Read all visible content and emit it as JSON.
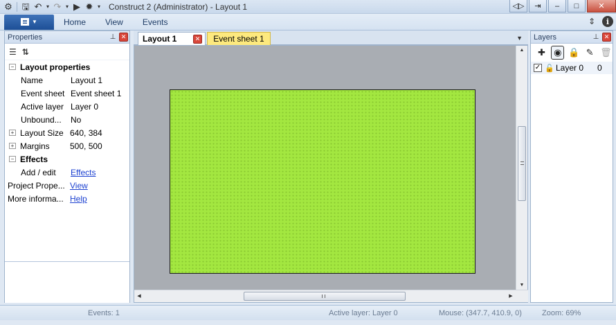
{
  "window": {
    "title": "Construct 2 (Administrator) - Layout 1",
    "buttons": {
      "restore": "◁▷",
      "help": "⇥",
      "minimize": "–",
      "maximize": "□",
      "close": "✕"
    }
  },
  "quick_access": {
    "icons": [
      "construct-logo-icon",
      "save-icon",
      "undo-icon",
      "redo-icon",
      "run-icon",
      "debug-icon",
      "customize-icon"
    ]
  },
  "ribbon": {
    "tabs": [
      "Home",
      "View",
      "Events"
    ]
  },
  "properties": {
    "title": "Properties",
    "rows": [
      {
        "type": "category",
        "label": "Layout properties",
        "expander": "−"
      },
      {
        "key": "Name",
        "value": "Layout 1"
      },
      {
        "key": "Event sheet",
        "value": "Event sheet 1"
      },
      {
        "key": "Active layer",
        "value": "Layer 0"
      },
      {
        "key": "Unbound...",
        "value": "No"
      },
      {
        "key": "Layout Size",
        "value": "640, 384",
        "expander": "+"
      },
      {
        "key": "Margins",
        "value": "500, 500",
        "expander": "+"
      },
      {
        "type": "category",
        "label": "Effects",
        "expander": "−"
      },
      {
        "key": "Add / edit",
        "link": "Effects"
      },
      {
        "top": true,
        "key": "Project Prope...",
        "link": "View"
      },
      {
        "top": true,
        "key": "More informa...",
        "link": "Help"
      }
    ]
  },
  "document_tabs": [
    {
      "label": "Layout 1",
      "active": true
    },
    {
      "label": "Event sheet 1",
      "active": false
    }
  ],
  "colors": {
    "layout_background": "#a3e740",
    "canvas_background": "#a9adb3",
    "event_tab": "#fde97e"
  },
  "layers": {
    "title": "Layers",
    "items": [
      {
        "name": "Layer 0",
        "number": "0",
        "visible": true
      }
    ]
  },
  "status": {
    "events": "Events: 1",
    "active_layer": "Active layer: Layer 0",
    "mouse": "Mouse: (347.7, 410.9, 0)",
    "zoom": "Zoom: 69%"
  }
}
